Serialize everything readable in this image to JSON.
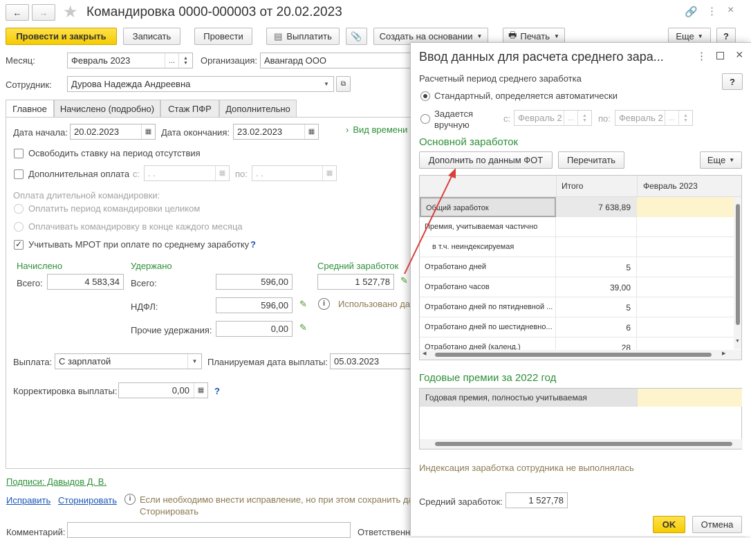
{
  "title": "Командировка 0000-000003 от 20.02.2023",
  "toolbar": {
    "post_close": "Провести и закрыть",
    "write": "Записать",
    "post": "Провести",
    "pay": "Выплатить",
    "create_based": "Создать на основании",
    "print": "Печать",
    "more": "Еще",
    "help": "?"
  },
  "main": {
    "month_label": "Месяц:",
    "month_value": "Февраль 2023",
    "org_label": "Организация:",
    "org_value": "Авангард ООО",
    "employee_label": "Сотрудник:",
    "employee_value": "Дурова Надежда Андреевна",
    "tabs": [
      "Главное",
      "Начислено (подробно)",
      "Стаж ПФР",
      "Дополнительно"
    ],
    "start_label": "Дата начала:",
    "start_value": "20.02.2023",
    "end_label": "Дата окончания:",
    "end_value": "23.02.2023",
    "time_view": "Вид времени",
    "free_rate": "Освободить ставку на период отсутствия",
    "extra_pay": "Дополнительная оплата",
    "from_label": "с:",
    "to_label": "по:",
    "date_empty": ". .",
    "long_trip": "Оплата длительной командировки:",
    "pay_whole": "Оплатить период командировки целиком",
    "pay_monthly": "Оплачивать командировку в конце каждого месяца",
    "mrot": "Учитывать МРОТ при оплате по среднему заработку",
    "q": "?",
    "accrued_header": "Начислено",
    "withheld_header": "Удержано",
    "avg_header": "Средний заработок",
    "total_label": "Всего:",
    "accrued_total": "4 583,34",
    "withheld_label": "Всего:",
    "withheld_total": "596,00",
    "ndfl_label": "НДФЛ:",
    "ndfl_value": "596,00",
    "other_label": "Прочие удержания:",
    "other_value": "0,00",
    "avg_value": "1 527,78",
    "used_text": "Использовано да",
    "payout_label": "Выплата:",
    "payout_value": "С зарплатой",
    "planned_label": "Планируемая дата выплаты:",
    "planned_value": "05.03.2023",
    "correction_label": "Корректировка выплаты:",
    "correction_value": "0,00",
    "signatures": "Подписи: Давыдов Д. В.",
    "fix": "Исправить",
    "storno": "Сторнировать",
    "info_line1": "Если необходимо внести исправление, но при этом сохранить да",
    "info_line2": "Сторнировать",
    "comment_label": "Комментарий:",
    "responsible_label": "Ответственны"
  },
  "dialog": {
    "title": "Ввод данных для расчета среднего зара...",
    "period_label": "Расчетный период среднего заработка",
    "help": "?",
    "opt_standard": "Стандартный, определяется автоматически",
    "opt_manual_1": "Задается",
    "opt_manual_2": "вручную",
    "from_label": "с:",
    "from_value": "Февраль 2",
    "to_label": "по:",
    "to_value": "Февраль 2",
    "main_section": "Основной заработок",
    "fill_fot": "Дополнить по данным ФОТ",
    "reread": "Перечитать",
    "more": "Еще",
    "grid": {
      "col_total": "Итого",
      "col_month": "Февраль 2023",
      "rows": [
        {
          "label": "Общий заработок",
          "total": "7 638,89"
        },
        {
          "label": "Премия, учитываемая частично",
          "total": ""
        },
        {
          "label": "в т.ч. неиндексируемая",
          "total": ""
        },
        {
          "label": "Отработано дней",
          "total": "5"
        },
        {
          "label": "Отработано часов",
          "total": "39,00"
        },
        {
          "label": "Отработано дней по пятидневной ...",
          "total": "5"
        },
        {
          "label": "Отработано дней по шестидневно...",
          "total": "6"
        },
        {
          "label": "Отработано дней (календ.)",
          "total": "28"
        }
      ]
    },
    "bonus_section": "Годовые премии за 2022 год",
    "bonus_row": "Годовая премия, полностью учитываемая",
    "indexation": "Индексация заработка сотрудника не выполнялась",
    "avg_label": "Средний заработок:",
    "avg_value": "1 527,78",
    "ok": "OK",
    "cancel": "Отмена"
  },
  "colors": {
    "accent": "#2e8f3a",
    "yellow_button": "#f5cc00",
    "highlight": "#fdf3cc",
    "arrow": "#d9403a"
  }
}
